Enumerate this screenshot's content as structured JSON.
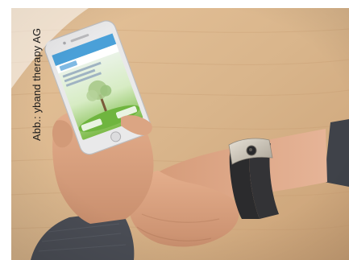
{
  "image": {
    "caption_credit": "Abb.: yband therapy AG",
    "colors": {
      "table_wood": "#d9b58b",
      "shadow_wood": "#c59e73",
      "skin": "#d8a17f",
      "sleeve": "#4a4d55",
      "phone_body": "#e9e9ea",
      "phone_screen_top": "#4aa0d8",
      "band_dark": "#2b2b2d",
      "band_metal": "#c9c2b6"
    },
    "icons": [
      "smartphone-icon",
      "wristband-icon",
      "tree-illustration-icon"
    ]
  }
}
